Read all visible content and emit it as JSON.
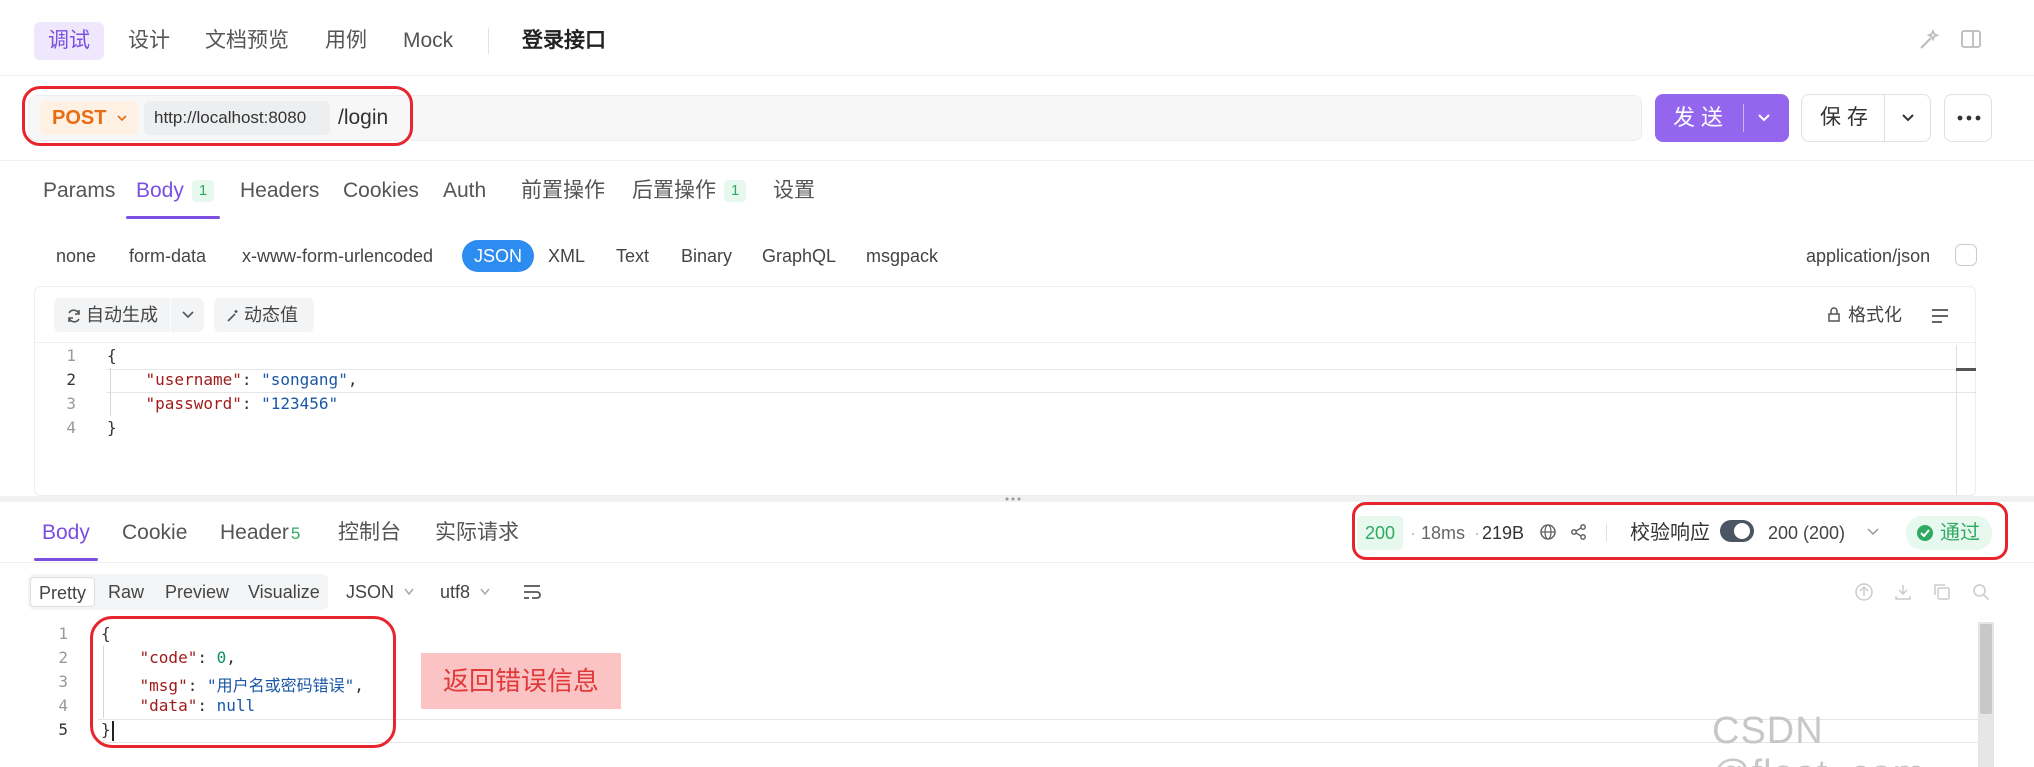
{
  "top_tabs": [
    "调试",
    "设计",
    "文档预览",
    "用例",
    "Mock"
  ],
  "api_name": "登录接口",
  "request": {
    "method": "POST",
    "host": "http://localhost:8080",
    "path": "/login",
    "send_label": "发送",
    "save_label": "保存"
  },
  "request_tabs": {
    "params": "Params",
    "body": "Body",
    "body_count": "1",
    "headers": "Headers",
    "cookies": "Cookies",
    "auth": "Auth",
    "pre": "前置操作",
    "post": "后置操作",
    "post_count": "1",
    "settings": "设置"
  },
  "body_types": [
    "none",
    "form-data",
    "x-www-form-urlencoded",
    "JSON",
    "XML",
    "Text",
    "Binary",
    "GraphQL",
    "msgpack"
  ],
  "content_type": "application/json",
  "editor": {
    "auto_generate": "自动生成",
    "dynamic_value": "动态值",
    "format": "格式化",
    "lines": [
      "1",
      "2",
      "3",
      "4"
    ],
    "code": {
      "open": "{",
      "k1": "\"username\"",
      "v1": "\"songang\"",
      "k2": "\"password\"",
      "v2": "\"123456\"",
      "close": "}"
    }
  },
  "response_tabs": {
    "body": "Body",
    "cookie": "Cookie",
    "header": "Header",
    "header_count": "5",
    "console": "控制台",
    "actual": "实际请求"
  },
  "response_meta": {
    "status": "200",
    "time": "18ms",
    "size": "219B",
    "validate_label": "校验响应",
    "expected": "200 (200)",
    "pass": "通过"
  },
  "response_view": {
    "modes": [
      "Pretty",
      "Raw",
      "Preview",
      "Visualize"
    ],
    "format": "JSON",
    "encoding": "utf8",
    "lines": [
      "1",
      "2",
      "3",
      "4",
      "5"
    ],
    "code": {
      "open": "{",
      "k1": "\"code\"",
      "v1": "0",
      "k2": "\"msg\"",
      "v2": "\"用户名或密码错误\"",
      "k3": "\"data\"",
      "v3": "null",
      "close": "}"
    }
  },
  "annotation": "返回错误信息",
  "watermark": "CSDN @float_com",
  "colors": {
    "accent": "#7b4fe0",
    "send": "#9466ee",
    "method": "#e86c13",
    "success": "#2faa62",
    "json_chip": "#2d8cf0",
    "highlight_box": "#e8242d"
  }
}
